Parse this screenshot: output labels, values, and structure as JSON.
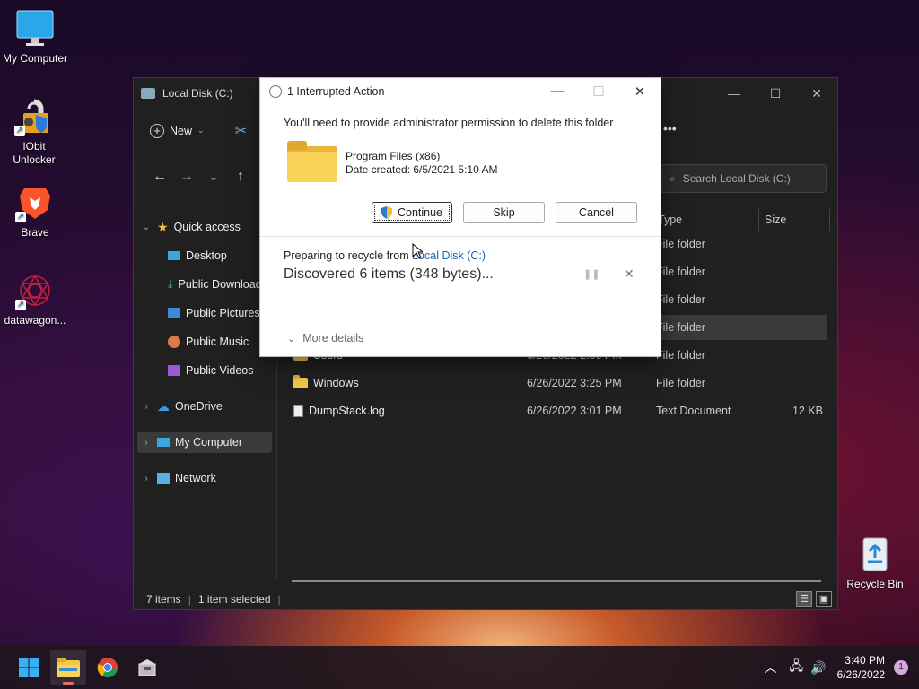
{
  "desktop": {
    "icons": [
      {
        "label": "My Computer",
        "icon": "monitor-icon"
      },
      {
        "label": "IObit Unlocker",
        "icon": "iobit-unlocker-icon"
      },
      {
        "label": "Brave",
        "icon": "brave-lion-icon"
      },
      {
        "label": "datawagon...",
        "icon": "datawagon-icon"
      },
      {
        "label": "Recycle Bin",
        "icon": "recycle-bin-icon"
      }
    ]
  },
  "explorer": {
    "title": "Local Disk (C:)",
    "new_label": "New",
    "more_label": "•••",
    "search_placeholder": "Search Local Disk (C:)",
    "columns": {
      "type": "Type",
      "size": "Size"
    },
    "nav": {
      "quick_access": "Quick access",
      "desktop": "Desktop",
      "downloads": "Public Downloads",
      "pictures": "Public Pictures",
      "music": "Public Music",
      "videos": "Public Videos",
      "onedrive": "OneDrive",
      "mycomputer": "My Computer",
      "network": "Network"
    },
    "rows": [
      {
        "name": "",
        "date": "",
        "type": "File folder",
        "size": ""
      },
      {
        "name": "",
        "date": "",
        "type": "File folder",
        "size": ""
      },
      {
        "name": "",
        "date": "",
        "type": "File folder",
        "size": ""
      },
      {
        "name": "",
        "date": "",
        "type": "File folder",
        "size": ""
      },
      {
        "name": "Users",
        "date": "6/26/2022 2:56 PM",
        "type": "File folder",
        "size": ""
      },
      {
        "name": "Windows",
        "date": "6/26/2022 3:25 PM",
        "type": "File folder",
        "size": ""
      },
      {
        "name": "DumpStack.log",
        "date": "6/26/2022 3:01 PM",
        "type": "Text Document",
        "size": "12 KB"
      }
    ],
    "status": {
      "count": "7 items",
      "selected": "1 item selected"
    }
  },
  "dialog": {
    "title": "1 Interrupted Action",
    "message": "You'll need to provide administrator permission to delete this folder",
    "folder_name": "Program Files (x86)",
    "date_created": "Date created: 6/5/2021 5:10 AM",
    "continue_label": "Continue",
    "skip_label": "Skip",
    "cancel_label": "Cancel",
    "preparing_text": "Preparing to recycle from ",
    "preparing_link": "Local Disk (C:)",
    "discovered": "Discovered 6 items (348 bytes)...",
    "more_details": "More details"
  },
  "taskbar": {
    "time": "3:40 PM",
    "date": "6/26/2022",
    "notifications": "1"
  }
}
